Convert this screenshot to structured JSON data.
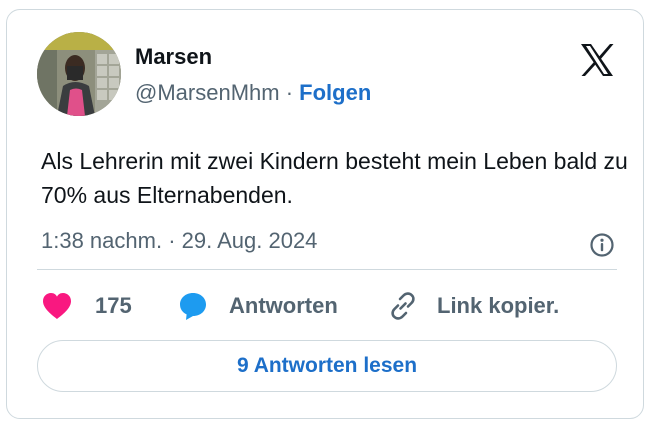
{
  "tweet": {
    "author_name": "Marsen",
    "author_handle": "@MarsenMhm",
    "separator": "·",
    "follow_label": "Folgen",
    "text": "Als Lehrerin mit zwei Kindern besteht mein Leben bald zu 70% aus Elternabenden.",
    "timestamp": "1:38 nachm. · 29. Aug. 2024"
  },
  "actions": {
    "like_count": "175",
    "reply_label": "Antworten",
    "copy_link_label": "Link kopier."
  },
  "read_replies_label": "9 Antworten lesen",
  "colors": {
    "like": "#f91880",
    "reply": "#1d9bf0",
    "link": "#1d6fc9",
    "muted": "#536471",
    "border": "#cfd9de"
  },
  "icons": [
    "x-logo-icon",
    "info-icon",
    "heart-icon",
    "reply-bubble-icon",
    "link-icon"
  ]
}
